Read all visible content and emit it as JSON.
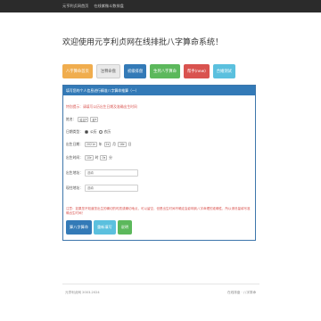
{
  "topbar": {
    "links": [
      "元亨利贞网首页",
      "在线紫微斗数排盘"
    ]
  },
  "title": "欢迎使用元亨利贞网在线排批八字算命系统！",
  "nav": [
    {
      "label": "八字算命首页",
      "color": "#f0ad4e"
    },
    {
      "label": "注释命盘",
      "color": "#e9e9e9"
    },
    {
      "label": "初级排盘",
      "color": "#337ab7"
    },
    {
      "label": "生死八字算命",
      "color": "#5cb85c"
    },
    {
      "label": "帮手(new)",
      "color": "#d9534f"
    },
    {
      "label": "合婚测试",
      "color": "#5bc0de"
    }
  ],
  "panel": {
    "heading": "填写您的个人信息进行精准八字算命推算（一）",
    "notice": "特别提示：请填写公历出生日期及准确出生时间",
    "form": {
      "name_label": "姓名：",
      "surname_select": "姓名",
      "gender_select": "男",
      "calendar_label": "日期类型：",
      "calendar_options": [
        "公历",
        "农历"
      ],
      "birth_date_label": "出生日期：",
      "birth_year": "2021",
      "birth_month": "1",
      "birth_day": "16",
      "unit_year": "年",
      "unit_month": "月",
      "unit_day": "日",
      "birth_time_label": "出生时间：",
      "birth_hour": "10",
      "birth_minute": "0",
      "unit_hour": "时",
      "unit_minute": "分",
      "birthplace_label": "出生地址：",
      "birthplace_placeholder": "选填",
      "residence_label": "现住地址：",
      "residence_placeholder": "选填",
      "note": "注意：如果您不知道您出生的确切的时辰或确切地点，可以留空，但是出生时间不确定会影响到八字命理的准确性，所以请尽量填写准确出生时间！"
    },
    "buttons": [
      {
        "label": "算八字算命",
        "color": "#337ab7"
      },
      {
        "label": "重新填写",
        "color": "#5bc0de"
      },
      {
        "label": "说明",
        "color": "#5cb85c"
      }
    ]
  },
  "footer": {
    "left": "元亨利贞网 2003-2024",
    "right": "在线排盘 · 八字算命"
  }
}
